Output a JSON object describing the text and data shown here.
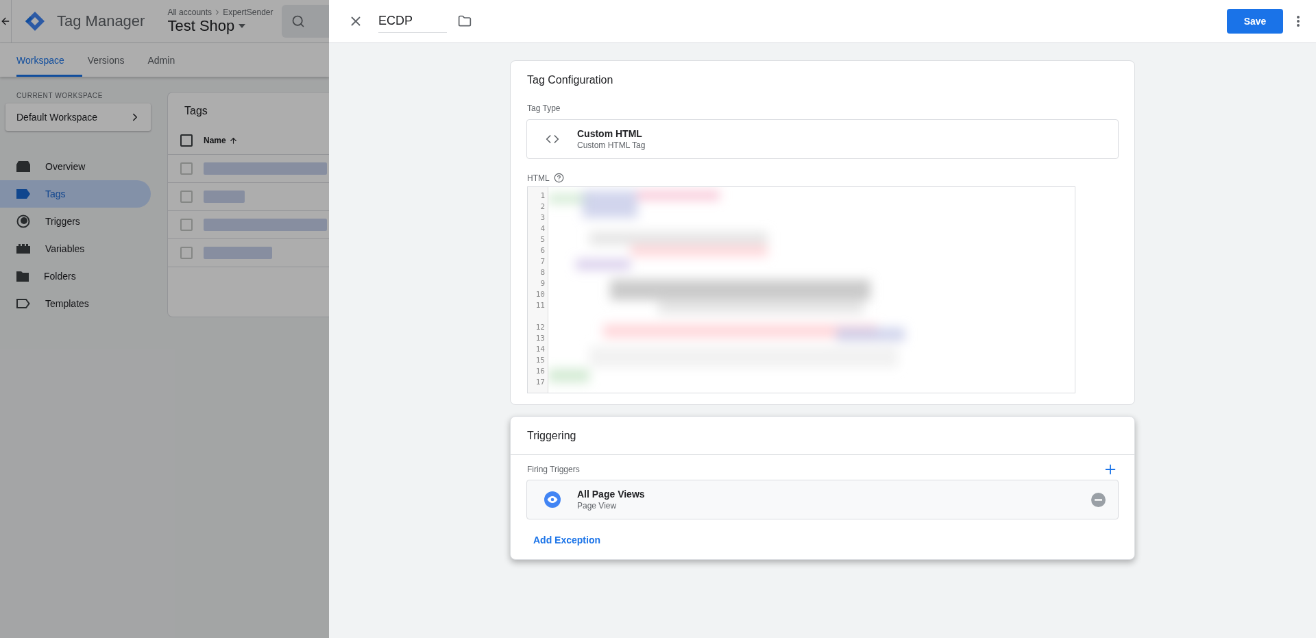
{
  "app": {
    "product": "Tag Manager",
    "breadcrumb": [
      "All accounts",
      "ExpertSender"
    ],
    "container": "Test Shop"
  },
  "tabs": [
    {
      "label": "Workspace",
      "selected": true
    },
    {
      "label": "Versions",
      "selected": false
    },
    {
      "label": "Admin",
      "selected": false
    }
  ],
  "workspace": {
    "heading": "CURRENT WORKSPACE",
    "name": "Default Workspace"
  },
  "nav": [
    {
      "label": "Overview",
      "kind": "overview",
      "selected": false
    },
    {
      "label": "Tags",
      "kind": "tags",
      "selected": true
    },
    {
      "label": "Triggers",
      "kind": "triggers",
      "selected": false
    },
    {
      "label": "Variables",
      "kind": "variables",
      "selected": false
    },
    {
      "label": "Folders",
      "kind": "folders",
      "selected": false
    },
    {
      "label": "Templates",
      "kind": "templates",
      "selected": false
    }
  ],
  "tags_list": {
    "title": "Tags",
    "column": "Name",
    "all_checked": false,
    "rows": [
      {
        "checked": false
      },
      {
        "checked": false
      },
      {
        "checked": false
      },
      {
        "checked": false
      }
    ]
  },
  "editor": {
    "name": "ECDP",
    "save": "Save",
    "config": {
      "title": "Tag Configuration",
      "type_label": "Tag Type",
      "type_name": "Custom HTML",
      "type_desc": "Custom HTML Tag",
      "html_label": "HTML",
      "line_numbers": [
        {
          "n": "1",
          "wrapped": false
        },
        {
          "n": "2",
          "wrapped": false
        },
        {
          "n": "3",
          "wrapped": false
        },
        {
          "n": "4",
          "wrapped": false
        },
        {
          "n": "5",
          "wrapped": false
        },
        {
          "n": "6",
          "wrapped": false
        },
        {
          "n": "7",
          "wrapped": false
        },
        {
          "n": "8",
          "wrapped": false
        },
        {
          "n": "9",
          "wrapped": false
        },
        {
          "n": "10",
          "wrapped": false
        },
        {
          "n": "11",
          "wrapped": true
        },
        {
          "n": "12",
          "wrapped": false
        },
        {
          "n": "13",
          "wrapped": false
        },
        {
          "n": "14",
          "wrapped": false
        },
        {
          "n": "15",
          "wrapped": false
        },
        {
          "n": "16",
          "wrapped": false
        },
        {
          "n": "17",
          "wrapped": false
        }
      ]
    },
    "triggering": {
      "title": "Triggering",
      "label": "Firing Triggers",
      "triggers": [
        {
          "name": "All Page Views",
          "type": "Page View"
        }
      ],
      "add_exception": "Add Exception"
    }
  }
}
